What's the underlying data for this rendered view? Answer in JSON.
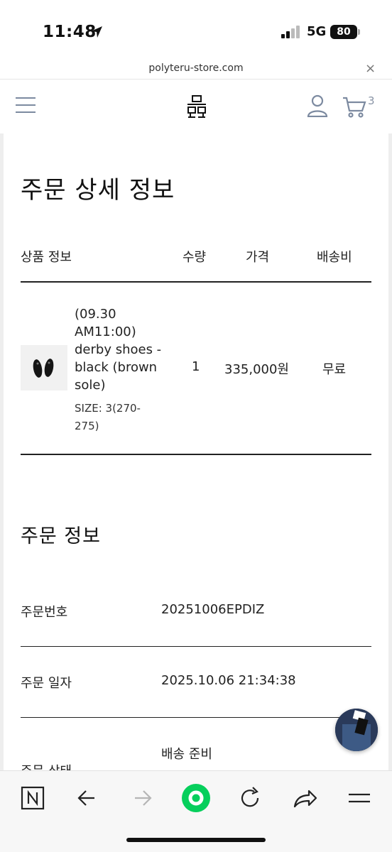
{
  "status_bar": {
    "time": "11:48",
    "network": "5G",
    "battery": "80"
  },
  "browser": {
    "url": "polyteru-store.com",
    "close_label": "×",
    "cart_count": "3"
  },
  "page": {
    "title": "주문 상세 정보",
    "table_headers": {
      "product": "상품 정보",
      "qty": "수량",
      "price": "가격",
      "shipping": "배송비"
    },
    "item": {
      "name": "(09.30 AM11:00) derby shoes - black (brown sole)",
      "size": "SIZE: 3(270-275)",
      "qty": "1",
      "price": "335,000원",
      "shipping": "무료"
    },
    "order_info_title": "주문 정보",
    "order_rows": [
      {
        "label": "주문번호",
        "value": "20251006EPDIZ"
      },
      {
        "label": "주문 일자",
        "value": "2025.10.06 21:34:38"
      },
      {
        "label": "주문 상태",
        "value": "배송 준비"
      }
    ]
  },
  "icons": [
    "location-arrow-icon",
    "signal-icon",
    "menu-icon",
    "brand-logo-icon",
    "user-icon",
    "cart-icon",
    "naver-icon",
    "back-arrow-icon",
    "forward-arrow-icon",
    "green-home-icon",
    "reload-icon",
    "share-icon",
    "more-menu-icon"
  ],
  "colors": {
    "header_icon": "#7c8aa0",
    "green_button": "#06cf5c",
    "text": "#111111"
  }
}
